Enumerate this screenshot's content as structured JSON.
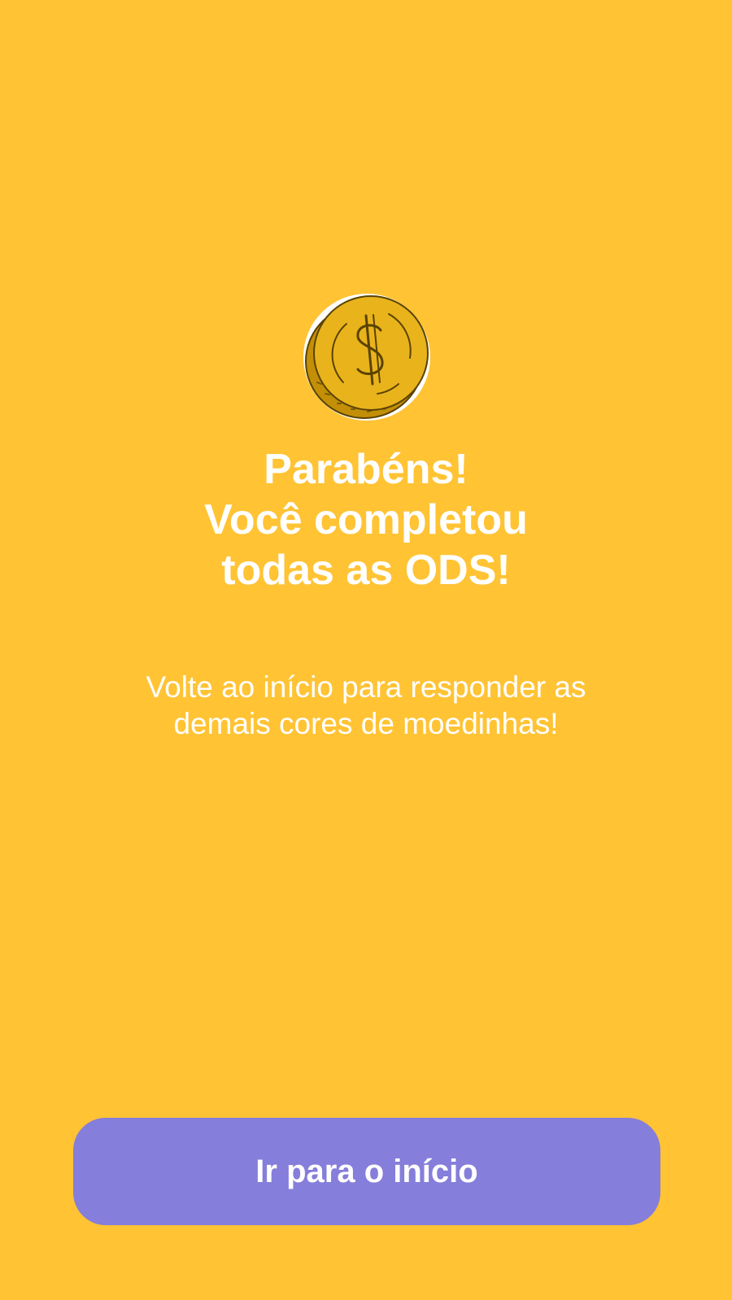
{
  "colors": {
    "background": "#FFC334",
    "button": "#857EDA",
    "text": "#FFFFFF",
    "coin_fill": "#E9B31C",
    "coin_edge": "#C38F06",
    "coin_outline": "#5A4300"
  },
  "illustration": {
    "icon": "gold-coin-dollar-icon"
  },
  "message": {
    "title_lines": [
      "Parabéns!",
      "Você completou",
      "todas as ODS!"
    ],
    "subtitle_lines": [
      "Volte ao início para responder as",
      "demais cores de moedinhas!"
    ]
  },
  "actions": {
    "home_label": "Ir para o início"
  }
}
